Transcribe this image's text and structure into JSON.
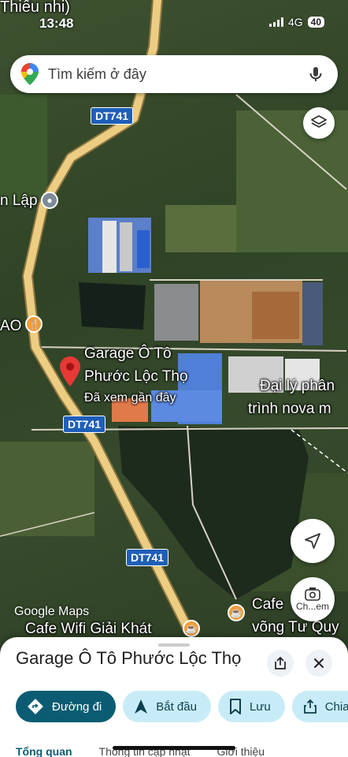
{
  "status_bar": {
    "time": "13:48",
    "network": "4G",
    "battery": "40"
  },
  "search": {
    "placeholder": "Tìm kiếm ở đây"
  },
  "map": {
    "labels": {
      "top_left": "Thiếu nhi)",
      "lap": "n Lập",
      "ao": "AO",
      "garage_line1": "Garage Ô Tô",
      "garage_line2": "Phước Lộc Thọ",
      "garage_sub": "Đã xem gần đây",
      "dai_ly_line1": "Đại lý phân",
      "dai_ly_line2": "trình nova m",
      "cafe_right_line1": "Cafe",
      "cafe_right_line2": "võng Tư Quy",
      "cafe_wifi": "Cafe Wifi Giải Khát",
      "google_maps": "Google Maps"
    },
    "road_shields": [
      "DT741",
      "DT741",
      "DT741"
    ],
    "camera_label": "Ch...em"
  },
  "sheet": {
    "title": "Garage Ô Tô Phước Lộc Thọ",
    "actions": {
      "directions": "Đường đi",
      "start": "Bắt đầu",
      "save": "Lưu",
      "share": "Chia"
    },
    "tabs": [
      "Tổng quan",
      "Thông tin cập nhật",
      "Giới thiệu"
    ]
  },
  "colors": {
    "primary": "#0b5c73",
    "secondary": "#c8ecf7",
    "road": "#e8c77a",
    "shield": "#1f5fb8"
  }
}
